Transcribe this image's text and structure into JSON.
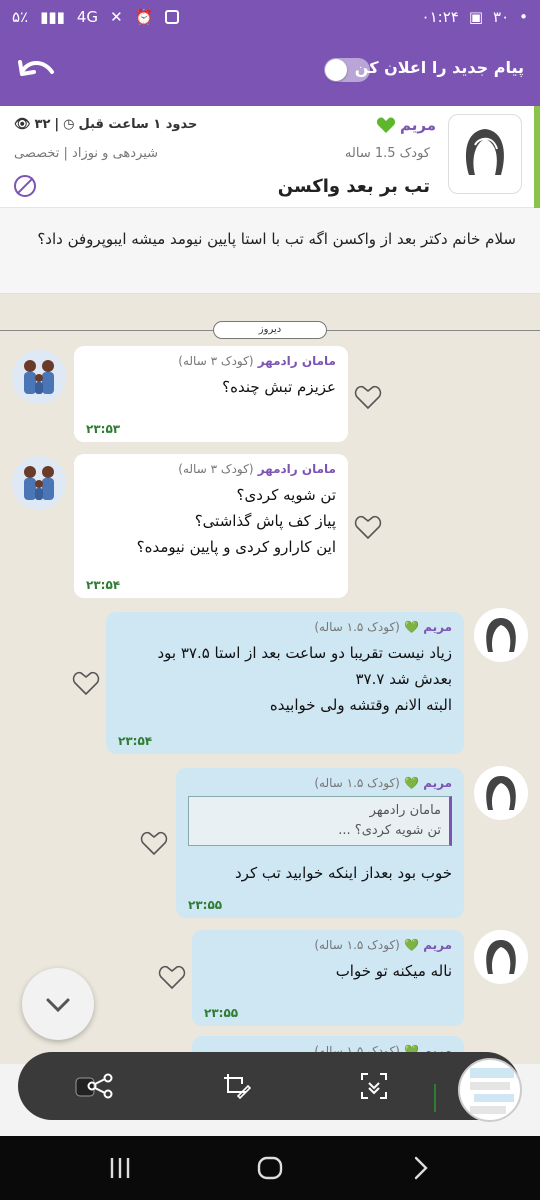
{
  "status_bar": {
    "time": "۰۱:۲۴",
    "battery": "۵٪",
    "network": "4G",
    "badge": "۳۰"
  },
  "app_bar": {
    "notify_label": "پیام جدید را اعلان کن",
    "toggle_on": false
  },
  "topic": {
    "author": "مریم",
    "child_age": "کودک 1.5 ساله",
    "title": "تب بر بعد واکسن",
    "time_ago": "حدود ۱ ساعت قبل",
    "views": "۳۲",
    "category": "شیردهی و نوزاد | تخصصی"
  },
  "question": {
    "text": "سلام خانم دکتر بعد از واکسن اگه تب با استا پایین نیومد میشه ایبوپروفن داد؟"
  },
  "chat": {
    "date_label": "دیروز",
    "messages": [
      {
        "name": "مامان رادمهر",
        "sub": "(کودک ۳ ساله)",
        "text": "عزیزم تبش چنده؟",
        "time": "۲۳:۵۳"
      },
      {
        "name": "مامان رادمهر",
        "sub": "(کودک ۳ ساله)",
        "text": "تن شویه کردی؟\nپیاز کف پاش گذاشتی؟\nاین کارارو کردی و پایین نیومده؟",
        "time": "۲۳:۵۴"
      },
      {
        "name": "مریم",
        "sub": "(کودک ۱.۵ ساله)",
        "text": "زیاد نیست تقریبا دو ساعت بعد از استا ۳۷.۵ بود بعدش شد ۳۷.۷\nالبته الانم وقتشه ولی خوابیده",
        "time": "۲۳:۵۴"
      },
      {
        "name": "مریم",
        "sub": "(کودک ۱.۵ ساله)",
        "quote_name": "مامان رادمهر",
        "quote_text": "تن شویه کردی؟ ...",
        "text": "خوب بود بعداز اینکه خوابید تب کرد",
        "time": "۲۳:۵۵"
      },
      {
        "name": "مریم",
        "sub": "(کودک ۱.۵ ساله)",
        "text": "ناله میکنه تو خواب",
        "time": "۲۳:۵۵"
      },
      {
        "name": "مریم",
        "sub": "(کودک ۱.۵ ساله)"
      }
    ]
  },
  "colors": {
    "primary": "#7c54b4",
    "accent_green": "#8bc34a",
    "outgoing_bubble": "#cfe6f3",
    "time_green": "#2e7d32"
  },
  "icons": {
    "back": "back-arrow-icon",
    "heart": "heart-outline-icon",
    "share": "share-icon",
    "edit": "crop-edit-icon",
    "scan": "scan-text-icon",
    "chevron": "chevron-down-icon"
  }
}
